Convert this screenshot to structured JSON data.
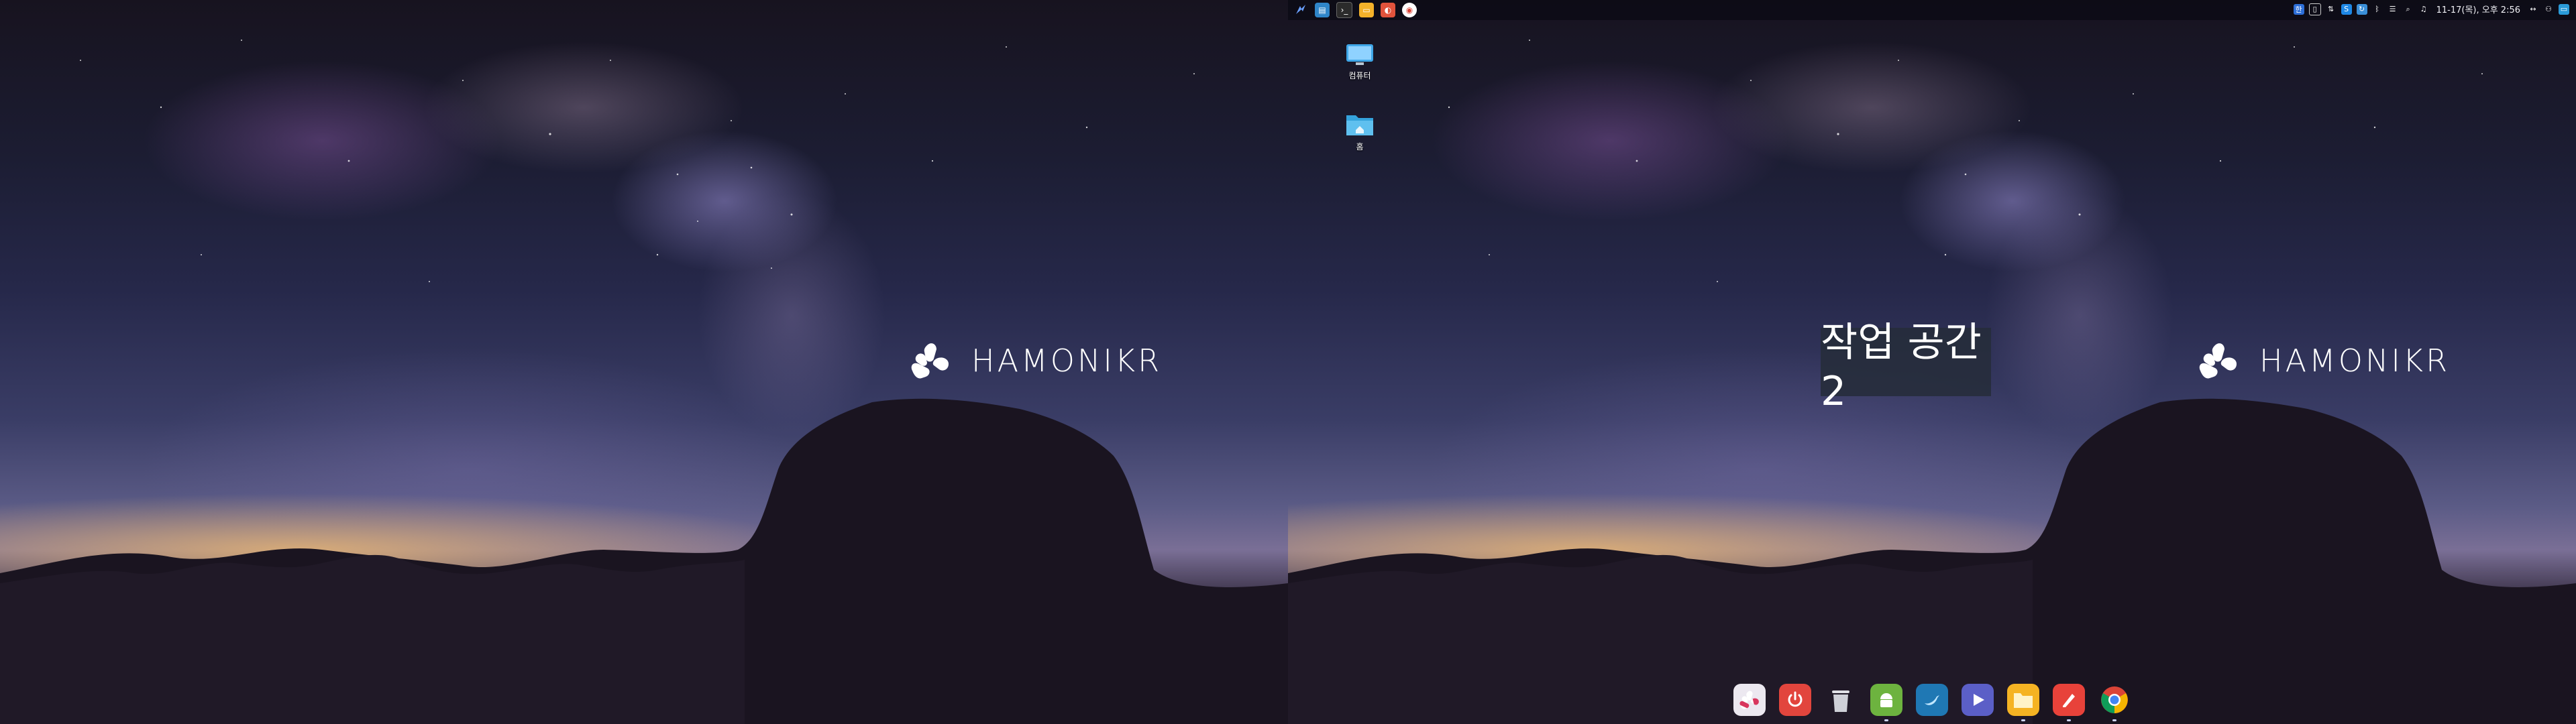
{
  "brand": {
    "logo_text": "HAMONIKR"
  },
  "panel": {
    "launcher_icons": [
      {
        "name": "menu-launcher-icon",
        "color": "#3d6fd1"
      },
      {
        "name": "app-store-icon",
        "color": "#2f86c9"
      },
      {
        "name": "terminal-icon",
        "color": "#2b2b2b"
      },
      {
        "name": "files-icon",
        "color": "#f3b22a"
      },
      {
        "name": "browser-icon",
        "color": "#e0533c"
      },
      {
        "name": "chrome-icon",
        "color": "#ffffff"
      }
    ],
    "clock": "11-17(목), 오후 2:56"
  },
  "desktop_icons": [
    {
      "label": "컴퓨터",
      "icon": "computer-icon",
      "color": "#3fa7e8"
    },
    {
      "label": "홈",
      "icon": "home-folder-icon",
      "color": "#35a3dc"
    }
  ],
  "workspace_osd": {
    "label": "작업 공간 2"
  },
  "dock": {
    "items": [
      {
        "name": "hamonikr-menu-icon",
        "color": "#e9e6ee"
      },
      {
        "name": "power-icon",
        "color": "#e2453d"
      },
      {
        "name": "trash-icon",
        "color": "#d9d9de"
      },
      {
        "name": "android-app-icon",
        "color": "#6db33f"
      },
      {
        "name": "bird-app-icon",
        "color": "#1f78b4"
      },
      {
        "name": "media-player-icon",
        "color": "#5b5fc7"
      },
      {
        "name": "file-manager-icon",
        "color": "#f5b323"
      },
      {
        "name": "text-editor-icon",
        "color": "#e8423a"
      },
      {
        "name": "chrome-icon",
        "color": "#ffffff"
      }
    ]
  }
}
